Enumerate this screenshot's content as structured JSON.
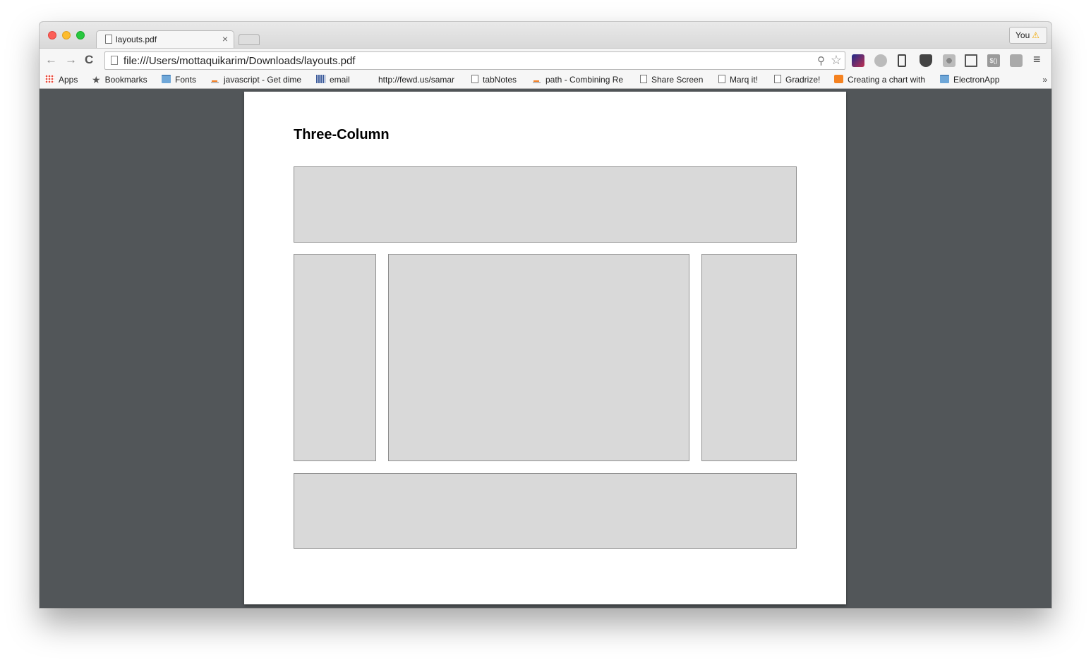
{
  "tab": {
    "title": "layouts.pdf",
    "close_glyph": "×"
  },
  "profile": {
    "label": "You",
    "warn_glyph": "⚠"
  },
  "toolbar": {
    "back_glyph": "←",
    "forward_glyph": "→",
    "reload_glyph": "C",
    "url": "file:///Users/mottaquikarim/Downloads/layouts.pdf",
    "menu_glyph": "≡"
  },
  "bookmarks": {
    "items": [
      {
        "label": "Apps",
        "icon": "apps-icon"
      },
      {
        "label": "Bookmarks",
        "icon": "star-icon"
      },
      {
        "label": "Fonts",
        "icon": "folder-icon"
      },
      {
        "label": "javascript - Get dime",
        "icon": "stackoverflow-icon"
      },
      {
        "label": "email",
        "icon": "grid-icon"
      },
      {
        "label": "http://fewd.us/samar",
        "icon": "none"
      },
      {
        "label": "tabNotes",
        "icon": "page-icon"
      },
      {
        "label": "path - Combining Re",
        "icon": "stackoverflow-icon"
      },
      {
        "label": "Share Screen",
        "icon": "page-icon"
      },
      {
        "label": "Marq it!",
        "icon": "page-icon"
      },
      {
        "label": "Gradrize!",
        "icon": "page-icon"
      },
      {
        "label": "Creating a chart with",
        "icon": "rss-icon"
      },
      {
        "label": "ElectronApp",
        "icon": "folder-icon"
      }
    ],
    "overflow_glyph": "»"
  },
  "pdf": {
    "title": "Three-Column"
  },
  "extensions": {
    "ext7_text": "$()"
  }
}
